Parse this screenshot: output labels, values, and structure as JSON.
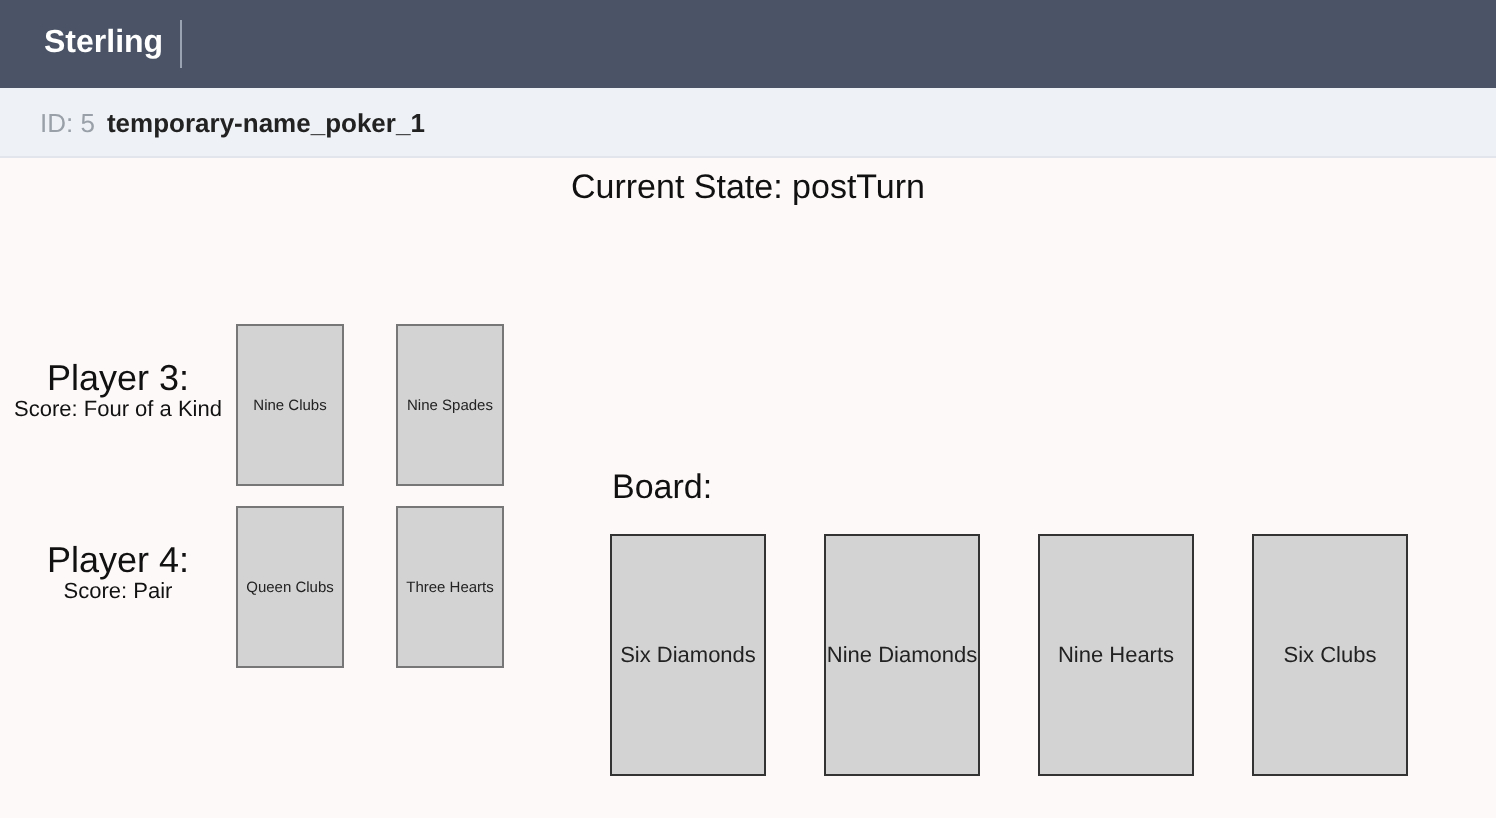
{
  "app": {
    "title": "Sterling"
  },
  "instance": {
    "id_label": "ID: 5",
    "name": "temporary-name_poker_1"
  },
  "state_title": "Current State: postTurn",
  "players": [
    {
      "name": "Player 3:",
      "score": "Score: Four of a Kind",
      "cards": [
        "Nine Clubs",
        "Nine Spades"
      ]
    },
    {
      "name": "Player 4:",
      "score": "Score: Pair",
      "cards": [
        "Queen Clubs",
        "Three Hearts"
      ]
    }
  ],
  "board": {
    "label": "Board:",
    "cards": [
      "Six Diamonds",
      "Nine Diamonds",
      "Nine Hearts",
      "Six Clubs"
    ]
  }
}
